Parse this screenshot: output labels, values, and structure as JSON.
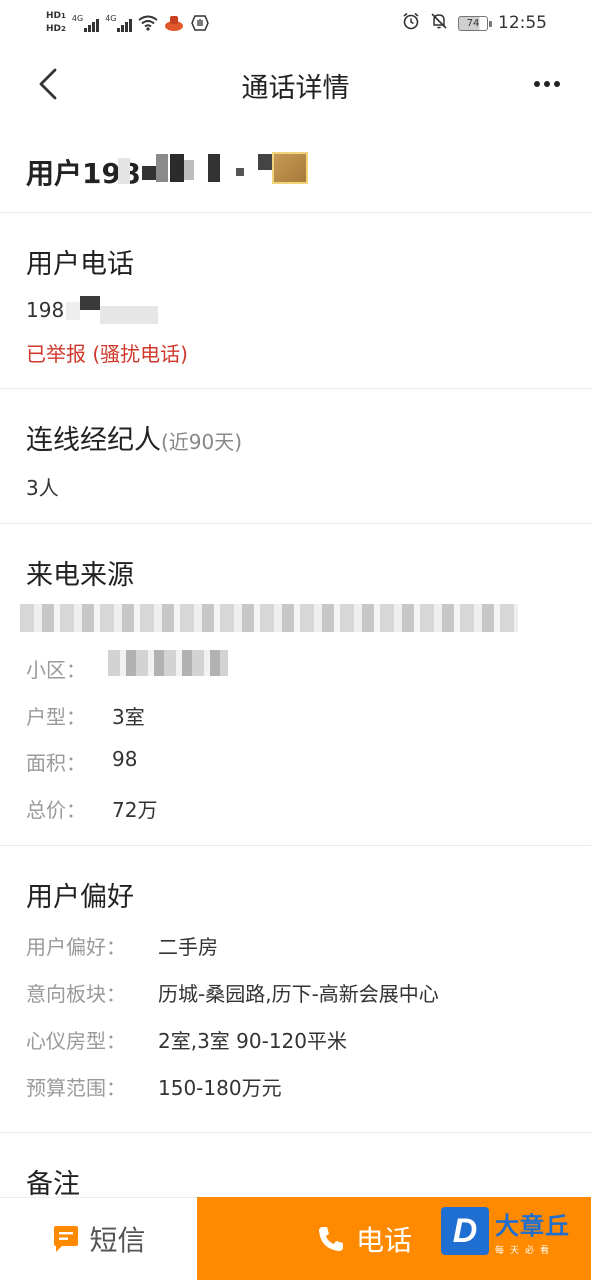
{
  "status_bar": {
    "hd_top": "HD",
    "hd_top_sub": "1",
    "hd_bottom": "HD",
    "hd_bottom_sub": "2",
    "net1": "4G",
    "net2": "4G",
    "battery": "74",
    "time": "12:55"
  },
  "nav": {
    "title": "通话详情"
  },
  "user": {
    "name_prefix": "用户198"
  },
  "phone_section": {
    "title": "用户电话",
    "number_prefix": "198",
    "report_status": "已举报 (骚扰电话)"
  },
  "agents_section": {
    "title": "连线经纪人",
    "title_note": "(近90天)",
    "count": "3人"
  },
  "source_section": {
    "title": "来电来源",
    "fields": [
      {
        "key": "小区：",
        "value": ""
      },
      {
        "key": "户型：",
        "value": "3室"
      },
      {
        "key": "面积：",
        "value": "98"
      },
      {
        "key": "总价：",
        "value": "72万"
      }
    ]
  },
  "preference_section": {
    "title": "用户偏好",
    "fields": [
      {
        "key": "用户偏好：",
        "value": "二手房"
      },
      {
        "key": "意向板块：",
        "value": "历城-桑园路,历下-高新会展中心"
      },
      {
        "key": "心仪房型：",
        "value": "2室,3室 90-120平米"
      },
      {
        "key": "预算范围：",
        "value": "150-180万元"
      }
    ]
  },
  "notes_section": {
    "title": "备注"
  },
  "bottom_bar": {
    "sms_label": "短信",
    "call_label": "电话"
  },
  "watermark": {
    "letter": "D",
    "brand": "大章丘",
    "slogan": "每天必看"
  },
  "colors": {
    "accent_orange": "#ff8a00",
    "report_red": "#d0382c",
    "muted_gray": "#9a9a9a",
    "watermark_blue": "#1e6fd1"
  }
}
